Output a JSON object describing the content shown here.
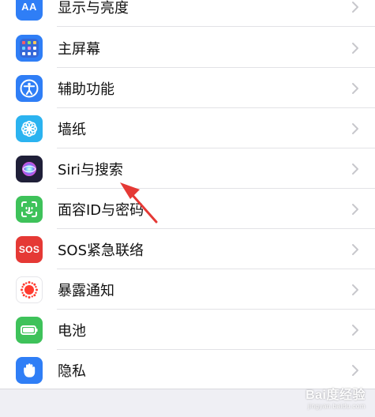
{
  "settings": {
    "items": [
      {
        "label": "显示与亮度",
        "icon": "text-size-icon",
        "badge": "AA"
      },
      {
        "label": "主屏幕",
        "icon": "home-screen-grid-icon"
      },
      {
        "label": "辅助功能",
        "icon": "accessibility-icon"
      },
      {
        "label": "墙纸",
        "icon": "wallpaper-flower-icon"
      },
      {
        "label": "Siri与搜索",
        "icon": "siri-icon"
      },
      {
        "label": "面容ID与密码",
        "icon": "face-id-icon"
      },
      {
        "label": "SOS紧急联络",
        "icon": "sos-icon",
        "badge": "SOS"
      },
      {
        "label": "暴露通知",
        "icon": "exposure-notification-icon"
      },
      {
        "label": "电池",
        "icon": "battery-icon"
      },
      {
        "label": "隐私",
        "icon": "privacy-hand-icon"
      }
    ]
  },
  "colors": {
    "blue": "#2f7ef6",
    "purple_dark": "#1f1f38",
    "green": "#3ec25a",
    "red": "#e53935",
    "accent_arrow": "#e53935"
  },
  "watermark": {
    "title": "Bai度经验",
    "sub": "jingyan.baidu.com"
  }
}
